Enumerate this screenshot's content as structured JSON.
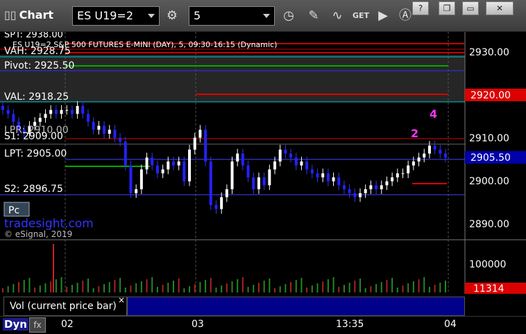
{
  "window": {
    "title": "Chart",
    "symbol": "ES U19=2",
    "interval": "5",
    "buttons": {
      "help": "?",
      "restore": "❐",
      "min": "▭",
      "close": "✕"
    },
    "icons": [
      "settings-icon",
      "clock-icon",
      "pencil-icon",
      "study-icon",
      "get-icon",
      "play-icon",
      "cursor-icon"
    ]
  },
  "chart": {
    "header": "ES U19=2 S&P 500 FUTURES E-MINI (DAY), 5, 09:30-16:15 (Dynamic)",
    "levels": {
      "s_top": "SPT: 2938.00",
      "vah": "VAH: 2928.75",
      "pivot": "Pivot: 2925.50",
      "val": "VAL: 2918.25",
      "r": "LPR: 2910.00",
      "s1": "S1: 2909.00",
      "lpt": "LPT: 2905.00",
      "s2": "S2: 2896.75"
    },
    "price_axis": [
      "2930.00",
      "2910.00",
      "2900.00",
      "2890.00"
    ],
    "price_marker_red": "2920.00",
    "price_marker_current": "2905.50",
    "watermark": "tradesight.com",
    "copyright": "© eSignal, 2019",
    "pc_badge": "Pc",
    "annotations": {
      "magenta_2": "2",
      "magenta_4": "4"
    }
  },
  "volume": {
    "label": "Vol (current price bar)",
    "axis_top": "100000",
    "current": "11314",
    "close_label": "×"
  },
  "x_axis": {
    "labels": [
      "02",
      "03",
      "13:35",
      "04"
    ],
    "dyn": "Dyn"
  },
  "chart_data": {
    "type": "candlestick",
    "title": "ES U19=2 S&P 500 FUTURES E-MINI (DAY), 5, 09:30-16:15 (Dynamic)",
    "y_range": [
      2886,
      2936
    ],
    "y_ticks": [
      2930,
      2920,
      2910,
      2905.5,
      2900,
      2890
    ],
    "x_labels": [
      "02",
      "03",
      "13:35",
      "04"
    ],
    "horizontal_levels": [
      {
        "name": "VAH",
        "value": 2928.75,
        "color": "#00ffff"
      },
      {
        "name": "Pivot",
        "value": 2925.5,
        "color": "#00aa00"
      },
      {
        "name": "VAL",
        "value": 2918.25,
        "color": "#00ffff"
      },
      {
        "name": "S1",
        "value": 2909.0,
        "color": "#ff3333"
      },
      {
        "name": "LPT",
        "value": 2905.0,
        "color": "#4444ff"
      },
      {
        "name": "S2",
        "value": 2896.75,
        "color": "#4444ff"
      }
    ],
    "candles_close": [
      2917,
      2916,
      2914,
      2912,
      2911,
      2913,
      2914,
      2915,
      2916,
      2917,
      2916,
      2917,
      2917,
      2916,
      2918,
      2916,
      2914,
      2912,
      2913,
      2911,
      2912,
      2910,
      2909,
      2903,
      2896,
      2897,
      2902,
      2905,
      2903,
      2901,
      2902,
      2904,
      2903,
      2904,
      2899,
      2907,
      2910,
      2912,
      2904,
      2893,
      2892,
      2895,
      2897,
      2904,
      2906,
      2903,
      2900,
      2897,
      2900,
      2898,
      2902,
      2904,
      2907,
      2906,
      2905,
      2903,
      2904,
      2902,
      2901,
      2900,
      2901,
      2899,
      2900,
      2898,
      2897,
      2896,
      2895,
      2896,
      2897,
      2898,
      2897,
      2898,
      2899,
      2900,
      2901,
      2901,
      2903,
      2904,
      2905,
      2906,
      2908,
      2907,
      2906,
      2905
    ],
    "volume": {
      "axis": [
        100000
      ],
      "current_bar": 11314
    }
  },
  "colors": {
    "background": "#000000",
    "up_candle": "#ffffff",
    "down_candle": "#2222ff",
    "grid": "#555555",
    "accent_red": "#dd0000",
    "accent_blue": "#0000aa"
  }
}
